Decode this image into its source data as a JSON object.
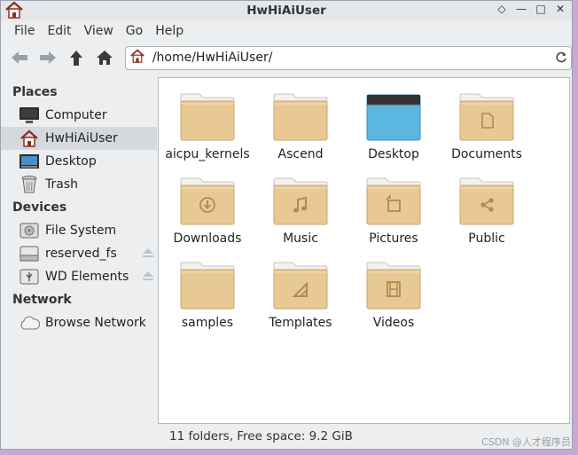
{
  "window": {
    "title": "HwHiAiUser"
  },
  "menubar": {
    "items": [
      "File",
      "Edit",
      "View",
      "Go",
      "Help"
    ]
  },
  "location": {
    "path": "/home/HwHiAiUser/"
  },
  "sidebar": {
    "sections": [
      {
        "header": "Places",
        "items": [
          {
            "label": "Computer",
            "icon": "computer-icon"
          },
          {
            "label": "HwHiAiUser",
            "icon": "home-icon",
            "active": true
          },
          {
            "label": "Desktop",
            "icon": "desktop-icon"
          },
          {
            "label": "Trash",
            "icon": "trash-icon"
          }
        ]
      },
      {
        "header": "Devices",
        "items": [
          {
            "label": "File System",
            "icon": "drive-icon"
          },
          {
            "label": "reserved_fs",
            "icon": "drive-icon",
            "eject": true
          },
          {
            "label": "WD Elements",
            "icon": "usb-drive-icon",
            "eject": true
          }
        ]
      },
      {
        "header": "Network",
        "items": [
          {
            "label": "Browse Network",
            "icon": "network-icon"
          }
        ]
      }
    ]
  },
  "folders": [
    {
      "name": "aicpu_kernels",
      "icon": "folder-icon"
    },
    {
      "name": "Ascend",
      "icon": "folder-icon"
    },
    {
      "name": "Desktop",
      "icon": "desktop-folder-icon"
    },
    {
      "name": "Documents",
      "icon": "documents-folder-icon"
    },
    {
      "name": "Downloads",
      "icon": "downloads-folder-icon"
    },
    {
      "name": "Music",
      "icon": "music-folder-icon"
    },
    {
      "name": "Pictures",
      "icon": "pictures-folder-icon"
    },
    {
      "name": "Public",
      "icon": "public-folder-icon"
    },
    {
      "name": "samples",
      "icon": "folder-icon"
    },
    {
      "name": "Templates",
      "icon": "templates-folder-icon"
    },
    {
      "name": "Videos",
      "icon": "videos-folder-icon"
    }
  ],
  "status": {
    "text": "11 folders, Free space: 9.2 GiB"
  },
  "watermark": "CSDN @人才程序员",
  "colors": {
    "folder": "#e8c994",
    "folder_back": "#d9b47a",
    "desktop_folder": "#5ab8e0"
  }
}
